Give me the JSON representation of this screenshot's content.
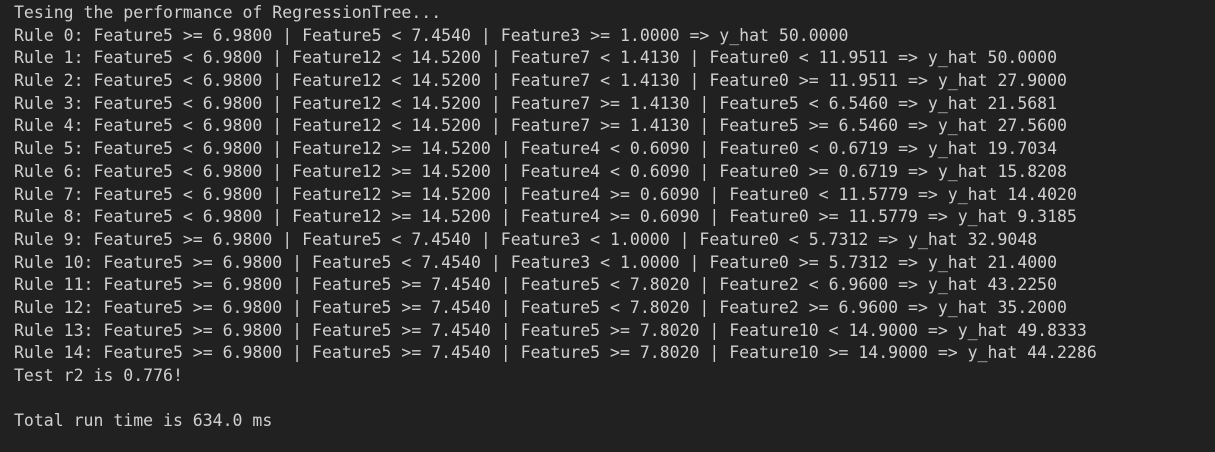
{
  "output": {
    "header": "Tesing the performance of RegressionTree...",
    "rules": [
      "Rule 0: Feature5 >= 6.9800 | Feature5 < 7.4540 | Feature3 >= 1.0000 => y_hat 50.0000",
      "Rule 1: Feature5 < 6.9800 | Feature12 < 14.5200 | Feature7 < 1.4130 | Feature0 < 11.9511 => y_hat 50.0000",
      "Rule 2: Feature5 < 6.9800 | Feature12 < 14.5200 | Feature7 < 1.4130 | Feature0 >= 11.9511 => y_hat 27.9000",
      "Rule 3: Feature5 < 6.9800 | Feature12 < 14.5200 | Feature7 >= 1.4130 | Feature5 < 6.5460 => y_hat 21.5681",
      "Rule 4: Feature5 < 6.9800 | Feature12 < 14.5200 | Feature7 >= 1.4130 | Feature5 >= 6.5460 => y_hat 27.5600",
      "Rule 5: Feature5 < 6.9800 | Feature12 >= 14.5200 | Feature4 < 0.6090 | Feature0 < 0.6719 => y_hat 19.7034",
      "Rule 6: Feature5 < 6.9800 | Feature12 >= 14.5200 | Feature4 < 0.6090 | Feature0 >= 0.6719 => y_hat 15.8208",
      "Rule 7: Feature5 < 6.9800 | Feature12 >= 14.5200 | Feature4 >= 0.6090 | Feature0 < 11.5779 => y_hat 14.4020",
      "Rule 8: Feature5 < 6.9800 | Feature12 >= 14.5200 | Feature4 >= 0.6090 | Feature0 >= 11.5779 => y_hat 9.3185",
      "Rule 9: Feature5 >= 6.9800 | Feature5 < 7.4540 | Feature3 < 1.0000 | Feature0 < 5.7312 => y_hat 32.9048",
      "Rule 10: Feature5 >= 6.9800 | Feature5 < 7.4540 | Feature3 < 1.0000 | Feature0 >= 5.7312 => y_hat 21.4000",
      "Rule 11: Feature5 >= 6.9800 | Feature5 >= 7.4540 | Feature5 < 7.8020 | Feature2 < 6.9600 => y_hat 43.2250",
      "Rule 12: Feature5 >= 6.9800 | Feature5 >= 7.4540 | Feature5 < 7.8020 | Feature2 >= 6.9600 => y_hat 35.2000",
      "Rule 13: Feature5 >= 6.9800 | Feature5 >= 7.4540 | Feature5 >= 7.8020 | Feature10 < 14.9000 => y_hat 49.8333",
      "Rule 14: Feature5 >= 6.9800 | Feature5 >= 7.4540 | Feature5 >= 7.8020 | Feature10 >= 14.9000 => y_hat 44.2286"
    ],
    "r2_line": "Test r2 is 0.776!",
    "runtime_line": "Total run time is 634.0 ms"
  },
  "colors": {
    "background": "#212121",
    "text": "#d0d0d0"
  }
}
